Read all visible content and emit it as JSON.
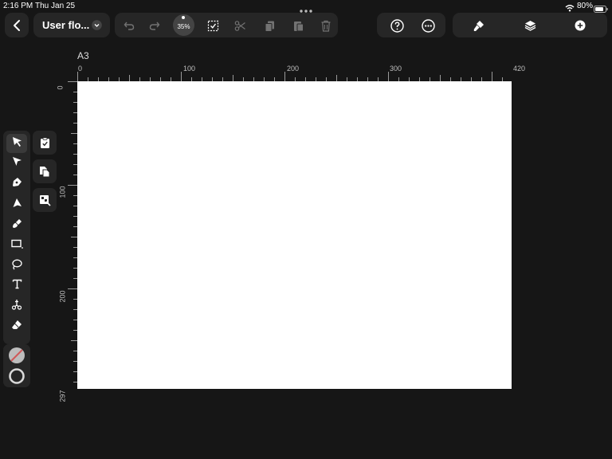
{
  "status_bar": {
    "time": "2:16 PM",
    "date": "Thu Jan 25",
    "battery": "80%"
  },
  "toolbar": {
    "document_title": "User flo...",
    "zoom_level": "35%"
  },
  "canvas": {
    "page_size_label": "A3",
    "ruler_x": [
      "0",
      "100",
      "200",
      "300",
      "420"
    ],
    "ruler_y": [
      "0",
      "100",
      "200",
      "297"
    ]
  },
  "icons": {
    "back": "chevron-left-icon",
    "title_menu": "chevron-down-icon",
    "undo": "undo-icon",
    "redo": "redo-icon",
    "select_all": "select-all-icon",
    "cut": "scissors-icon",
    "copy": "copy-icon",
    "paste": "paste-icon",
    "delete": "trash-icon",
    "help": "help-icon",
    "more": "more-icon",
    "brush": "brush-icon",
    "layers": "layers-icon",
    "add": "add-icon"
  },
  "colors": {
    "background": "#161616",
    "panel": "#262626",
    "canvas": "#ffffff",
    "stroke_none": "#d05a5a"
  }
}
